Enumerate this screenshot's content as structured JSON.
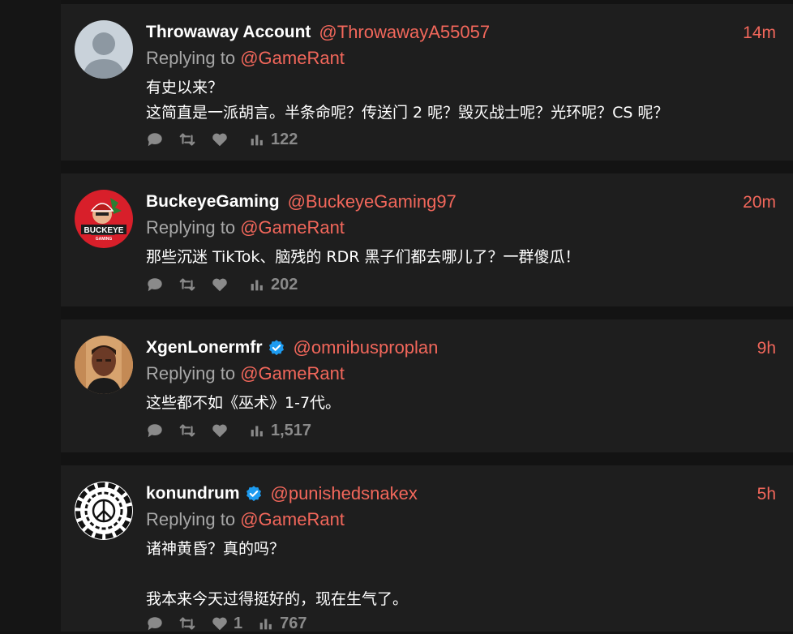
{
  "colors": {
    "page_bg": "#131313",
    "card_bg": "#1e1e1e",
    "accent": "#f2675b",
    "muted": "#a7a7a7",
    "icon": "#8a8a8a"
  },
  "tweets": [
    {
      "name": "Throwaway Account",
      "handle": "@ThrowawayA55057",
      "time": "14m",
      "reply_prefix": "Replying to",
      "reply_to": "@GameRant",
      "text": "有史以来？\n这简直是一派胡言。半条命呢？传送门 2 呢？毁灭战士呢？光环呢？CS 呢？",
      "likes": "",
      "views": "122",
      "verified": false,
      "avatar": "default-avatar-icon"
    },
    {
      "name": "BuckeyeGaming",
      "handle": "@BuckeyeGaming97",
      "time": "20m",
      "reply_prefix": "Replying to",
      "reply_to": "@GameRant",
      "text": "那些沉迷 TikTok、脑残的 RDR 黑子们都去哪儿了？一群傻瓜！",
      "likes": "",
      "views": "202",
      "verified": false,
      "avatar": "buckeye-logo-avatar",
      "avatar_text": "BUCKEYE",
      "avatar_subtext": "GAMING"
    },
    {
      "name": "XgenLonermfr",
      "handle": "@omnibusproplan",
      "time": "9h",
      "reply_prefix": "Replying to",
      "reply_to": "@GameRant",
      "text": "这些都不如《巫术》1-7代。",
      "likes": "",
      "views": "1,517",
      "verified": true,
      "avatar": "portrait-avatar"
    },
    {
      "name": "konundrum",
      "handle": "@punishedsnakex",
      "time": "5h",
      "reply_prefix": "Replying to",
      "reply_to": "@GameRant",
      "text": "诸神黄昏？真的吗？\n\n我本来今天过得挺好的，现在生气了。",
      "likes": "1",
      "views": "767",
      "verified": true,
      "avatar": "peace-symbol-avatar"
    }
  ]
}
